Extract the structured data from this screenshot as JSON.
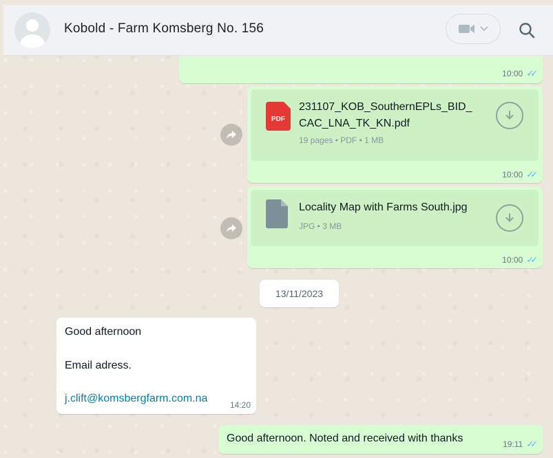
{
  "header": {
    "contact_name": "Kobold - Farm Komsberg No. 156",
    "video_icon": "video-call-icon",
    "search_icon": "search-icon"
  },
  "messages": {
    "top_partial": {
      "time": "10:00"
    },
    "file1": {
      "icon": "pdf-icon",
      "icon_label": "PDF",
      "name_line1": "231107_KOB_SouthernEPLs_BID_",
      "name_line2": "CAC_LNA_TK_KN.pdf",
      "meta": "19 pages • PDF • 1 MB",
      "time": "10:00"
    },
    "file2": {
      "icon": "file-icon",
      "name": "Locality Map with Farms South.jpg",
      "meta": "JPG • 3 MB",
      "time": "10:00"
    },
    "date_divider": "13/11/2023",
    "incoming": {
      "line1": "Good afternoon",
      "line2": "Email adress.",
      "email": "j.clift@komsbergfarm.com.na",
      "time": "14:20"
    },
    "outgoing_last": {
      "text": "Good afternoon. Noted and received with thanks",
      "time": "19:11"
    }
  },
  "colors": {
    "outgoing_bubble": "#d9fdd3",
    "incoming_bubble": "#ffffff",
    "read_ticks": "#53bdeb",
    "link": "#027eb5",
    "pdf_red": "#e53935"
  }
}
